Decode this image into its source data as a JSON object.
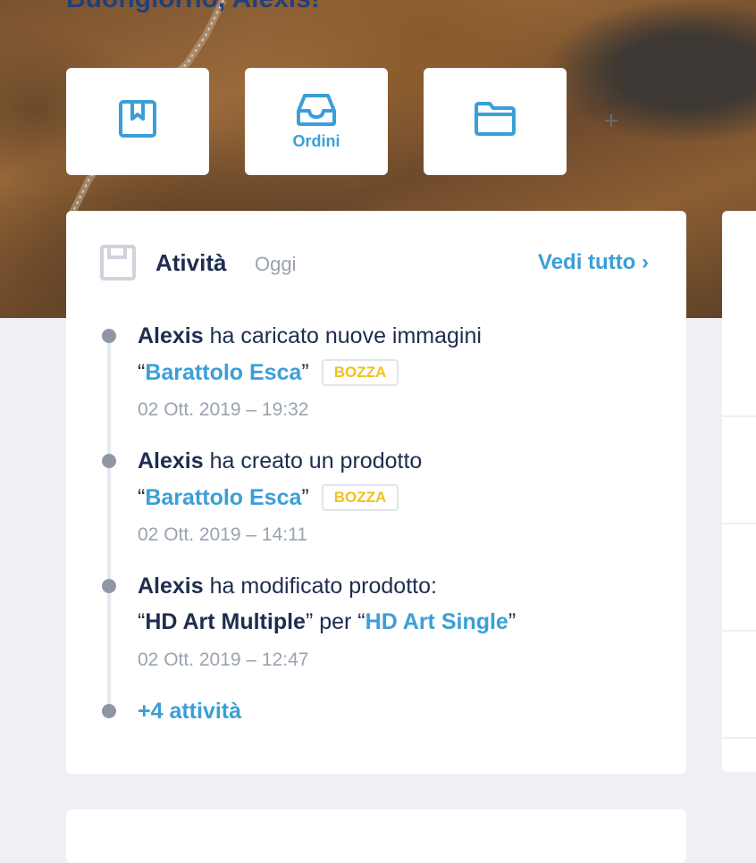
{
  "hero": {
    "greeting": "Buongiorno, Alexis!"
  },
  "quick_actions": [
    {
      "icon": "bookmark-icon",
      "label": ""
    },
    {
      "icon": "inbox-tray-icon",
      "label": "Ordini"
    },
    {
      "icon": "folder-icon",
      "label": ""
    }
  ],
  "activity": {
    "title": "Atività",
    "subtitle": "Oggi",
    "see_all": "Vedi tutto ›",
    "entries": [
      {
        "user": "Alexis",
        "action": "ha caricato nuove immagini",
        "quote_open": "“",
        "item": "Barattolo Esca",
        "quote_close": "”",
        "badge": "BOZZA",
        "time": "02 Ott. 2019 – 19:32"
      },
      {
        "user": "Alexis",
        "action": "ha creato un prodotto",
        "quote_open": "“",
        "item": "Barattolo Esca",
        "quote_close": "”",
        "badge": "BOZZA",
        "time": "02 Ott. 2019 – 14:11"
      },
      {
        "user": "Alexis",
        "action": "ha modificato prodotto:",
        "quote_open": "“",
        "from_item": "HD Art Multiple",
        "mid_text": "” per “",
        "to_item": "HD Art Single",
        "quote_close": "”",
        "time": "02 Ott. 2019 – 12:47"
      }
    ],
    "more": "+4 attività"
  },
  "colors": {
    "accent": "#3a9fd8",
    "title": "#1e2d4f",
    "muted": "#9aa3b0",
    "badge_text": "#f2c21b",
    "background": "#eef0f4"
  }
}
